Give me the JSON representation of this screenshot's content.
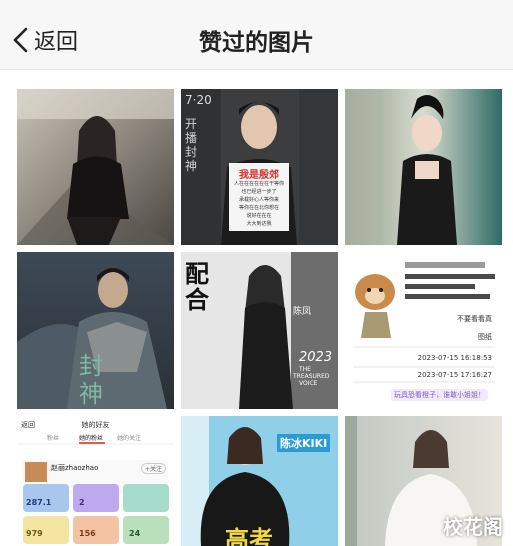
{
  "nav": {
    "back_label": "返回",
    "title": "赞过的图片"
  },
  "tiles": [
    {
      "name": "photo-woman-black-outfit"
    },
    {
      "name": "photo-man-holding-sign",
      "top_text": "7·20",
      "side_text": "开播封神",
      "sign_title": "我是殷郊",
      "sign_lines": [
        "人在在在在在在干等你",
        "也已经进一步了",
        "承载好心人等你来",
        "等你在在北你想在",
        "说好在在在",
        "大大到达我"
      ]
    },
    {
      "name": "photo-woman-black-dress"
    },
    {
      "name": "poster-armored-warrior",
      "side_text": "封神"
    },
    {
      "name": "poster-peipei",
      "char_a": "配",
      "char_b": "合",
      "side_name": "陈凤",
      "year": "2023",
      "en_lines": [
        "THE",
        "TREASURED",
        "VOICE"
      ]
    },
    {
      "name": "screenshot-dog-post",
      "rows": [
        "不要看看真",
        "图纸",
        "2023-07-15 16:18:53",
        "2023-07-15 17:16:27"
      ],
      "bubble": "玩具恐看橙子，谁敢小姐姐！"
    },
    {
      "name": "screenshot-profile-page",
      "back": "返回",
      "header": "她的好友",
      "tabs": [
        "粉丝",
        "她的粉丝",
        "她的关注"
      ],
      "username": "赵丽zhaozhao",
      "follow": "+关注",
      "stats": [
        "287.1",
        "2",
        "979",
        "156",
        "24"
      ]
    },
    {
      "name": "photo-woman-blue-background",
      "tag_text": "陈冰KIKI",
      "big_text": "高考"
    },
    {
      "name": "photo-woman-white-dress"
    }
  ],
  "watermark": "校花阁"
}
